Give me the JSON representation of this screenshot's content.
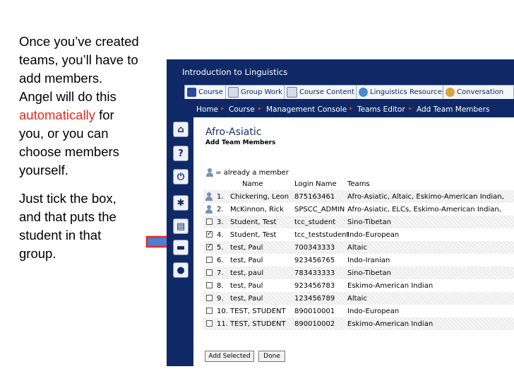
{
  "slide": {
    "intro_line1": "Once you’ve created",
    "intro_line2": "teams, you’ll have to",
    "intro_line3": "add members.",
    "intro_line4": "Angel will do this",
    "intro_highlight": "automatically",
    "intro_line5_rest": " for",
    "intro_line6": "you, or you can",
    "intro_line7": "choose members",
    "intro_line8": "yourself.",
    "tip_line1": "Just tick the box,",
    "tip_line2": "and that puts the",
    "tip_line3": "student in that",
    "tip_line4": "group.",
    "highlight_color": "#e8281e"
  },
  "app": {
    "course_title": "Introduction to Linguistics",
    "tabs": [
      {
        "label": "Course",
        "icon": "course-icon"
      },
      {
        "label": "Group Work",
        "icon": "group-work-icon"
      },
      {
        "label": "Course Content",
        "icon": "course-content-icon"
      },
      {
        "label": "Linguistics Resources",
        "icon": "globe-icon"
      },
      {
        "label": "Conversation",
        "icon": "conversation-icon"
      }
    ],
    "breadcrumb": [
      "Home",
      "Course",
      "Management Console",
      "Teams Editor",
      "Add Team Members"
    ],
    "page_title": "Afro-Asiatic",
    "page_subtitle": "Add Team Members",
    "legend": "= already a member",
    "columns": {
      "name": "Name",
      "login": "Login Name",
      "teams": "Teams"
    },
    "rows": [
      {
        "num": "1.",
        "name": "Chickering, Leon",
        "login": "875163461",
        "teams": "Afro-Asiatic, Altaic, Eskimo-American Indian,",
        "member": true,
        "checked": false
      },
      {
        "num": "2.",
        "name": "McKinnon, Rick",
        "login": "SPSCC_ADMIN",
        "teams": "Afro-Asiatic, ELCs, Eskimo-American Indian,",
        "member": true,
        "checked": false
      },
      {
        "num": "3.",
        "name": "Student, Test",
        "login": "tcc_student",
        "teams": "Sino-Tibetan",
        "member": false,
        "checked": false
      },
      {
        "num": "4.",
        "name": "Student, Test",
        "login": "tcc_teststudent",
        "teams": "Indo-European",
        "member": false,
        "checked": true
      },
      {
        "num": "5.",
        "name": "test, Paul",
        "login": "700343333",
        "teams": "Altaic",
        "member": false,
        "checked": true
      },
      {
        "num": "6.",
        "name": "test, Paul",
        "login": "923456765",
        "teams": "Indo-Iranian",
        "member": false,
        "checked": false
      },
      {
        "num": "7.",
        "name": "test, paul",
        "login": "783433333",
        "teams": "Sino-Tibetan",
        "member": false,
        "checked": false
      },
      {
        "num": "8.",
        "name": "test, Paul",
        "login": "923456783",
        "teams": "Eskimo-American Indian",
        "member": false,
        "checked": false
      },
      {
        "num": "9.",
        "name": "test, Paul",
        "login": "123456789",
        "teams": "Altaic",
        "member": false,
        "checked": false
      },
      {
        "num": "10.",
        "name": "TEST, STUDENT",
        "login": "890010001",
        "teams": "Indo-European",
        "member": false,
        "checked": false
      },
      {
        "num": "11.",
        "name": "TEST, STUDENT",
        "login": "890010002",
        "teams": "Eskimo-American Indian",
        "member": false,
        "checked": false
      }
    ],
    "add_selected_label": "Add Selected",
    "done_label": "Done",
    "sidebar_icons": [
      "home-icon",
      "help-icon",
      "power-icon",
      "settings-icon",
      "clipboard-icon",
      "folder-icon",
      "user-icon"
    ],
    "colors": {
      "header_navy": "#0e2966",
      "arrow_red": "#e8281e",
      "arrow_blue": "#4a7fd4"
    }
  }
}
